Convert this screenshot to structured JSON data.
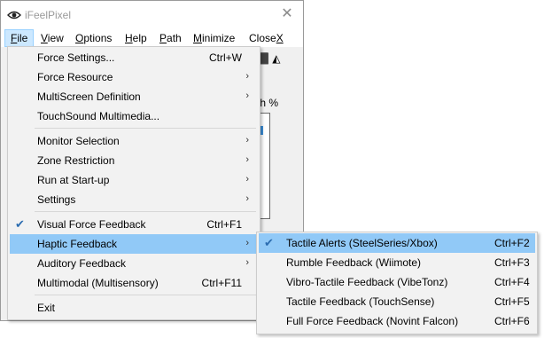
{
  "window": {
    "title": "iFeelPixel",
    "close_glyph": "✕",
    "app_icon": "eye-icon"
  },
  "menubar": {
    "items": [
      {
        "prefix": "",
        "under": "F",
        "rest": "ile"
      },
      {
        "prefix": "",
        "under": "V",
        "rest": "iew"
      },
      {
        "prefix": "",
        "under": "O",
        "rest": "ptions"
      },
      {
        "prefix": "",
        "under": "H",
        "rest": "elp"
      },
      {
        "prefix": "",
        "under": "P",
        "rest": "ath"
      },
      {
        "prefix": "",
        "under": "M",
        "rest": "inimize"
      },
      {
        "prefix": "Close",
        "under": "X",
        "rest": ""
      }
    ]
  },
  "background": {
    "toolbar_peek": "⬛ ◭",
    "label_peek": "th %"
  },
  "file_menu": {
    "items": [
      {
        "label": "Force Settings...",
        "shortcut": "Ctrl+W",
        "submenu": false,
        "checked": false
      },
      {
        "label": "Force Resource",
        "shortcut": "",
        "submenu": true,
        "checked": false
      },
      {
        "label": "MultiScreen Definition",
        "shortcut": "",
        "submenu": true,
        "checked": false
      },
      {
        "label": "TouchSound Multimedia...",
        "shortcut": "",
        "submenu": false,
        "checked": false
      },
      {
        "label": "Monitor Selection",
        "shortcut": "",
        "submenu": true,
        "checked": false
      },
      {
        "label": "Zone Restriction",
        "shortcut": "",
        "submenu": true,
        "checked": false
      },
      {
        "label": "Run at Start-up",
        "shortcut": "",
        "submenu": true,
        "checked": false
      },
      {
        "label": "Settings",
        "shortcut": "",
        "submenu": true,
        "checked": false
      },
      {
        "label": "Visual Force Feedback",
        "shortcut": "Ctrl+F1",
        "submenu": false,
        "checked": true
      },
      {
        "label": "Haptic Feedback",
        "shortcut": "",
        "submenu": true,
        "checked": false
      },
      {
        "label": "Auditory Feedback",
        "shortcut": "",
        "submenu": true,
        "checked": false
      },
      {
        "label": "Multimodal (Multisensory)",
        "shortcut": "Ctrl+F11",
        "submenu": false,
        "checked": false
      },
      {
        "label": "Exit",
        "shortcut": "",
        "submenu": false,
        "checked": false
      }
    ],
    "highlighted_index": 9
  },
  "haptic_submenu": {
    "items": [
      {
        "label": "Tactile Alerts (SteelSeries/Xbox)",
        "shortcut": "Ctrl+F2",
        "checked": true
      },
      {
        "label": "Rumble Feedback (Wiimote)",
        "shortcut": "Ctrl+F3",
        "checked": false
      },
      {
        "label": "Vibro-Tactile Feedback (VibeTonz)",
        "shortcut": "Ctrl+F4",
        "checked": false
      },
      {
        "label": "Tactile Feedback (TouchSense)",
        "shortcut": "Ctrl+F5",
        "checked": false
      },
      {
        "label": "Full Force Feedback (Novint Falcon)",
        "shortcut": "Ctrl+F6",
        "checked": false
      }
    ],
    "highlighted_index": 0
  },
  "glyphs": {
    "arrow": "›",
    "check": "✔"
  },
  "colors": {
    "highlight": "#91c9f7",
    "menubar_active": "#cce8ff",
    "menu_bg": "#f2f2f2"
  }
}
